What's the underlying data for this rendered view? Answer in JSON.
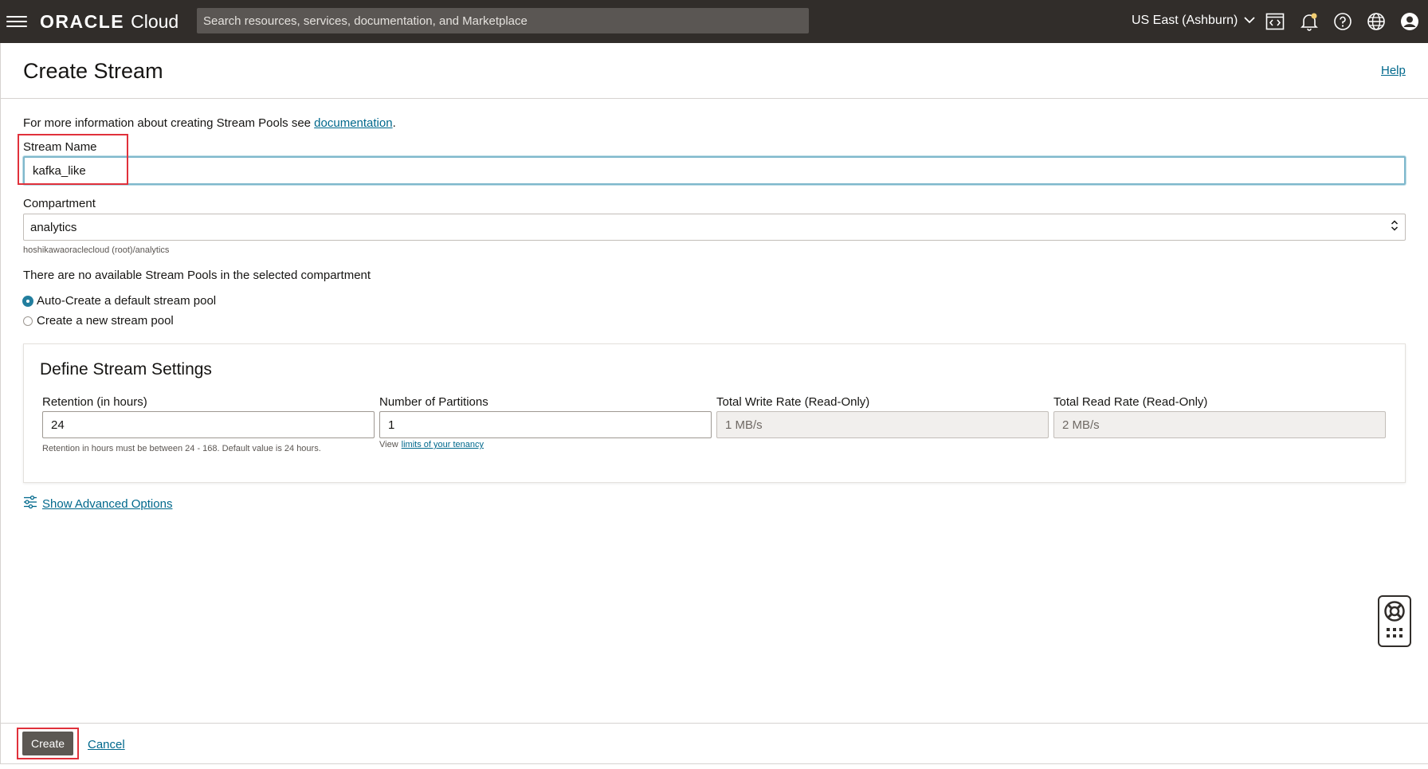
{
  "topbar": {
    "brand_oracle": "ORACLE",
    "brand_cloud": "Cloud",
    "search_placeholder": "Search resources, services, documentation, and Marketplace",
    "region": "US East (Ashburn)",
    "icons": [
      "menu-icon",
      "code-editor-icon",
      "bell-icon",
      "help-circle-icon",
      "globe-icon",
      "user-avatar-icon"
    ],
    "accent": "#312d2a"
  },
  "header": {
    "title": "Create Stream",
    "help": "Help"
  },
  "form": {
    "info_prefix": "For more information about creating Stream Pools see ",
    "info_link": "documentation",
    "info_suffix": ".",
    "stream_name_label": "Stream Name",
    "stream_name_value": "kafka_like",
    "compartment_label": "Compartment",
    "compartment_value": "analytics",
    "compartment_path": "hoshikawaoraclecloud (root)/analytics",
    "no_pools_notice": "There are no available Stream Pools in the selected compartment",
    "radio_auto": "Auto-Create a default stream pool",
    "radio_new": "Create a new stream pool",
    "selected_option": "Auto-Create a default stream pool"
  },
  "settings": {
    "title": "Define Stream Settings",
    "retention_label": "Retention (in hours)",
    "retention_value": "24",
    "retention_hint": "Retention in hours must be between 24 - 168. Default value is 24 hours.",
    "partitions_label": "Number of Partitions",
    "partitions_value": "1",
    "tenancy_prefix": "View",
    "tenancy_link": "limits of your tenancy",
    "write_label": "Total Write Rate (Read-Only)",
    "write_value": "1 MB/s",
    "read_label": "Total Read Rate (Read-Only)",
    "read_value": "2 MB/s"
  },
  "advanced": {
    "label": "Show Advanced Options"
  },
  "footer": {
    "create": "Create",
    "cancel": "Cancel"
  },
  "colors": {
    "link": "#00688c",
    "highlight": "#e0313b",
    "radio_selected": "#227e9e",
    "button": "#5c5853"
  }
}
